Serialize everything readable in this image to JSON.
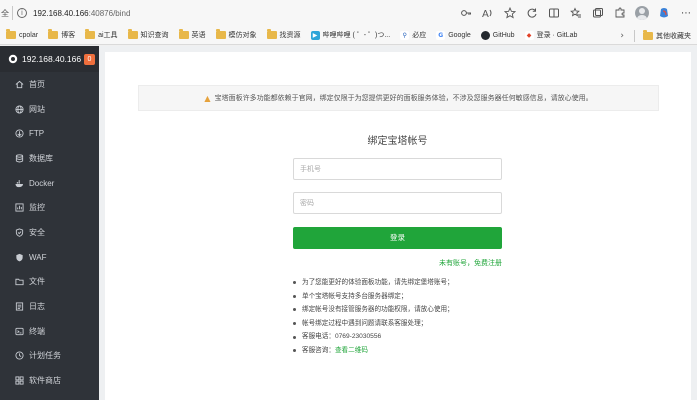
{
  "browser": {
    "left_glyph": "全",
    "url_host": "192.168.40.166",
    "url_path": ":40876/bind"
  },
  "bookmarks": {
    "items": [
      {
        "label": "cpolar",
        "kind": "folder"
      },
      {
        "label": "博客",
        "kind": "folder"
      },
      {
        "label": "ai工具",
        "kind": "folder"
      },
      {
        "label": "知识查询",
        "kind": "folder"
      },
      {
        "label": "英语",
        "kind": "folder"
      },
      {
        "label": "模仿对象",
        "kind": "folder"
      },
      {
        "label": "找资源",
        "kind": "folder"
      },
      {
        "label": "哔哩哔哩 ( ゜- ゜)つ...",
        "kind": "site",
        "color": "#2fa5d8",
        "glyph": "▶"
      },
      {
        "label": "必应",
        "kind": "site",
        "color": "#1b5ab8",
        "glyph": "b"
      },
      {
        "label": "Google",
        "kind": "site",
        "color": "#4285f4",
        "glyph": "G"
      },
      {
        "label": "GitHub",
        "kind": "site",
        "color": "#24292e",
        "glyph": "●"
      },
      {
        "label": "登录 · GitLab",
        "kind": "site",
        "color": "#e24329",
        "glyph": "◆"
      }
    ],
    "other_label": "其他收藏夹"
  },
  "sidebar": {
    "server_ip": "192.168.40.166",
    "badge": "0",
    "items": [
      {
        "label": "首页",
        "icon": "home-icon"
      },
      {
        "label": "网站",
        "icon": "globe-icon"
      },
      {
        "label": "FTP",
        "icon": "ftp-icon"
      },
      {
        "label": "数据库",
        "icon": "database-icon"
      },
      {
        "label": "Docker",
        "icon": "docker-icon"
      },
      {
        "label": "监控",
        "icon": "monitor-icon"
      },
      {
        "label": "安全",
        "icon": "shield-icon"
      },
      {
        "label": "WAF",
        "icon": "waf-icon"
      },
      {
        "label": "文件",
        "icon": "folder-icon"
      },
      {
        "label": "日志",
        "icon": "log-icon"
      },
      {
        "label": "终端",
        "icon": "terminal-icon"
      },
      {
        "label": "计划任务",
        "icon": "clock-icon"
      },
      {
        "label": "软件商店",
        "icon": "store-icon"
      }
    ]
  },
  "main": {
    "notice": "宝塔面板许多功能都依赖于官网，绑定仅限于为您提供更好的面板服务体验，不涉及您服务器任何敏感信息，请放心使用。",
    "title": "绑定宝塔帐号",
    "phone_placeholder": "手机号",
    "password_placeholder": "密码",
    "login_label": "登录",
    "register_label": "未有账号，免费注册",
    "tips": [
      "为了您能更好的体验面板功能，请先绑定堡塔账号；",
      "单个宝塔帐号支持多台服务器绑定；",
      "绑定帐号没有接管服务器的功能权限，请放心使用；",
      "帐号绑定过程中遇到问题请联系客服处理；",
      "客服电话：0769-23030556"
    ],
    "tip_wechat_prefix": "客服咨询：",
    "tip_wechat_link": "查看二维码"
  },
  "colors": {
    "accent_green": "#20a53a",
    "sidebar_bg": "#2f3339",
    "warning": "#e6a23c",
    "badge": "#ef6f3d"
  }
}
